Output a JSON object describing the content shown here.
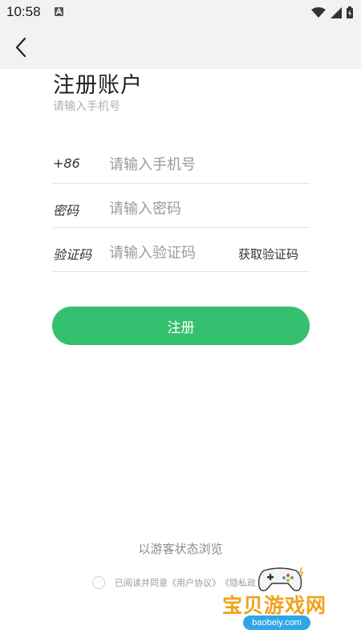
{
  "status_bar": {
    "time": "10:58",
    "icons": [
      "notification-a-icon",
      "wifi-icon",
      "cell-signal-icon",
      "battery-icon"
    ]
  },
  "header": {
    "back_icon": "chevron-left-icon"
  },
  "page": {
    "title": "注册账户",
    "subtitle": "请输入手机号"
  },
  "form": {
    "phone": {
      "label": "+86",
      "placeholder": "请输入手机号",
      "value": ""
    },
    "password": {
      "label": "密码",
      "placeholder": "请输入密码",
      "value": ""
    },
    "code": {
      "label": "验证码",
      "placeholder": "请输入验证码",
      "value": "",
      "get_code_label": "获取验证码"
    }
  },
  "actions": {
    "register_label": "注册",
    "guest_label": "以游客状态浏览"
  },
  "agreement": {
    "prefix": "已阅读并同意",
    "user_agreement": "《用户协议》",
    "privacy_partial": "《隐私政",
    "checked": false
  },
  "watermark": {
    "text": "宝贝游戏网",
    "url": "baobeiy.com"
  },
  "colors": {
    "accent": "#35c06f",
    "background": "#ffffff",
    "status_bar": "#f2f2f2",
    "watermark": "#f0a21c"
  }
}
